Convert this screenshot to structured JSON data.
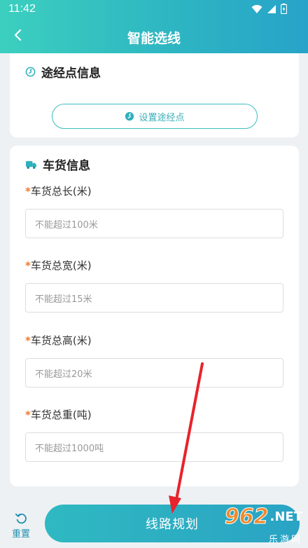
{
  "status_bar": {
    "time": "11:42"
  },
  "header": {
    "title": "智能选线"
  },
  "waypoint_section": {
    "title": "途经点信息",
    "set_waypoint_label": "设置途经点"
  },
  "cargo_section": {
    "title": "车货信息",
    "fields": [
      {
        "required_mark": "*",
        "label": "车货总长(米)",
        "placeholder": "不能超过100米"
      },
      {
        "required_mark": "*",
        "label": "车货总宽(米)",
        "placeholder": "不能超过15米"
      },
      {
        "required_mark": "*",
        "label": "车货总高(米)",
        "placeholder": "不能超过20米"
      },
      {
        "required_mark": "*",
        "label": "车货总重(吨)",
        "placeholder": "不能超过1000吨"
      }
    ]
  },
  "footer": {
    "reset_label": "重置",
    "plan_label": "线路规划"
  },
  "watermark": {
    "number": "962",
    "suffix": ".NET",
    "site": "乐游网"
  },
  "colors": {
    "accent": "#2eb6c2",
    "required": "#f0782a",
    "annotation_arrow": "#e8232b"
  }
}
